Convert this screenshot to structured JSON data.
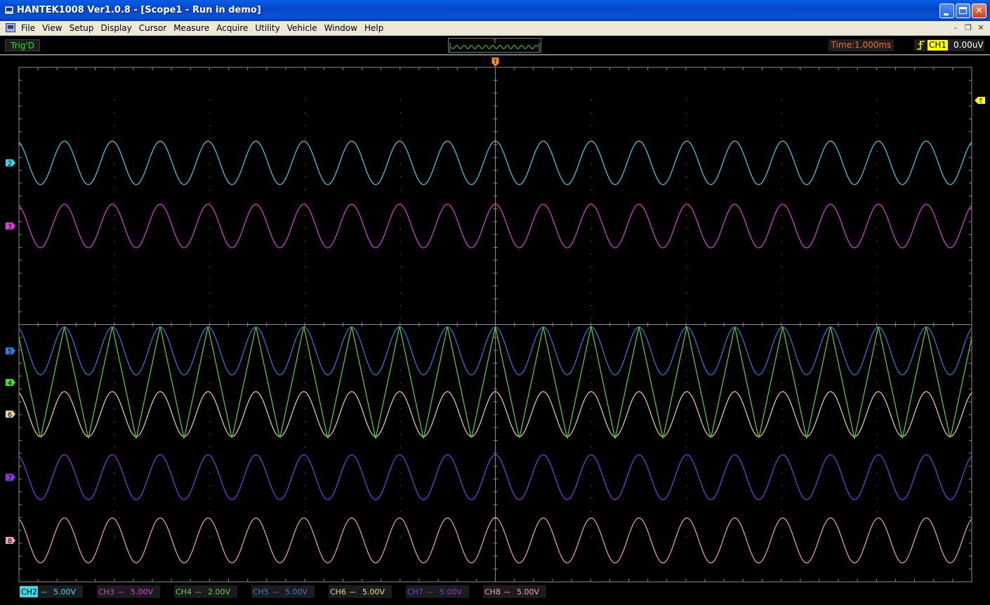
{
  "window": {
    "title": "HANTEK1008 Ver1.0.8 - [Scope1 - Run in demo]"
  },
  "menu": [
    "File",
    "View",
    "Setup",
    "Display",
    "Cursor",
    "Measure",
    "Acquire",
    "Utility",
    "Vehicle",
    "Window",
    "Help"
  ],
  "status": {
    "trigger_state": "Trig'D",
    "timebase": "Time:1.000ms",
    "trigger_source": "CH1",
    "trigger_level": "0.00uV",
    "trigger_marker_label": "T"
  },
  "channels": [
    {
      "id": "CH2",
      "marker": "2",
      "scale": "5.00V",
      "color": "#3fd6e8",
      "active": true
    },
    {
      "id": "CH3",
      "marker": "3",
      "scale": "5.00V",
      "color": "#e23ce0",
      "active": false
    },
    {
      "id": "CH4",
      "marker": "4",
      "scale": "2.00V",
      "color": "#55d640",
      "active": false
    },
    {
      "id": "CH5",
      "marker": "5",
      "scale": "5.00V",
      "color": "#2d7fe8",
      "active": false
    },
    {
      "id": "CH6",
      "marker": "6",
      "scale": "5.00V",
      "color": "#f0d890",
      "active": false
    },
    {
      "id": "CH7",
      "marker": "7",
      "scale": "5.00V",
      "color": "#8a36e6",
      "active": false
    },
    {
      "id": "CH8",
      "marker": "8",
      "scale": "5.00V",
      "color": "#f3a0c4",
      "active": false
    }
  ],
  "coupling_symbol": "⎓",
  "colors": {
    "trigger_orange": "#ff8a1c",
    "trigger_yellow": "#ffff00",
    "grid": "#8c8c8c"
  }
}
